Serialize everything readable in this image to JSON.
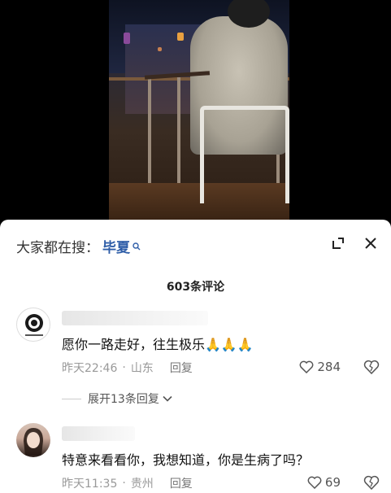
{
  "search": {
    "prefix": "大家都在搜：",
    "keyword": "毕夏"
  },
  "comments_header": {
    "count_label": "603条评论"
  },
  "comments": [
    {
      "text": "愿你一路走好，往生极乐🙏🙏🙏",
      "time": "昨天22:46",
      "location": "山东",
      "reply_label": "回复",
      "likes": "284",
      "expand_label": "展开13条回复"
    },
    {
      "text": "特意来看看你，我想知道，你是生病了吗？",
      "time": "昨天11:35",
      "location": "贵州",
      "reply_label": "回复",
      "likes": "69"
    }
  ],
  "colors": {
    "keyword": "#2f5ea8",
    "meta": "#999999"
  },
  "icons": [
    "search-icon",
    "minimize-icon",
    "close-icon",
    "heart-icon",
    "dislike-icon",
    "chevron-down-icon"
  ]
}
